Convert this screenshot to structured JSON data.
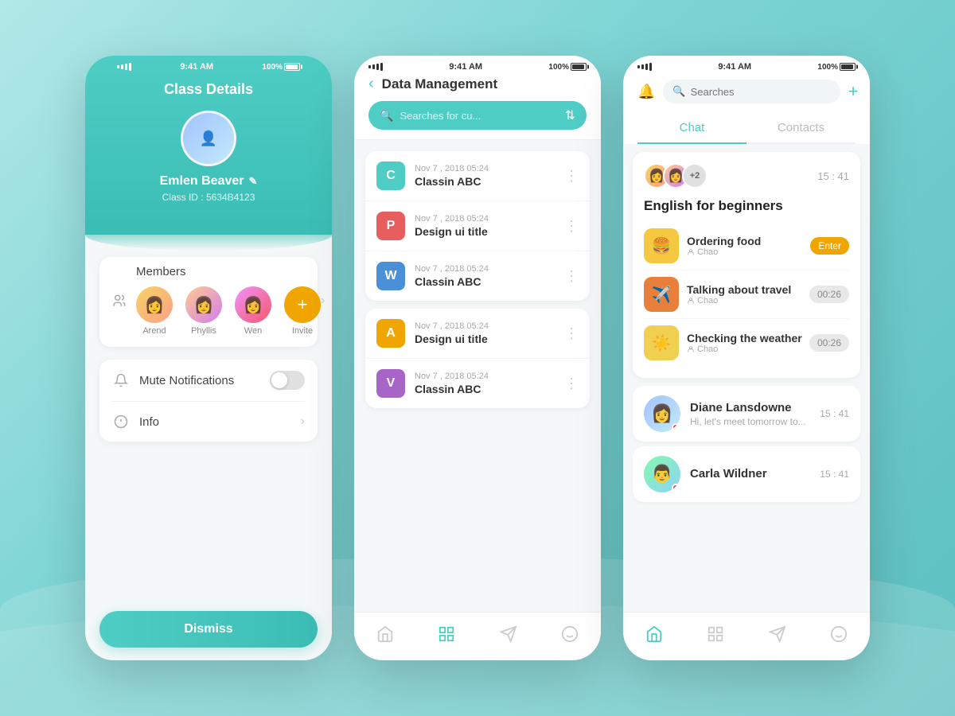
{
  "app": {
    "status_time": "9:41 AM",
    "status_battery": "100%"
  },
  "phone1": {
    "title": "Class Details",
    "user_name": "Emlen Beaver",
    "class_id": "Class ID : 5634B4123",
    "members_label": "Members",
    "mute_label": "Mute Notifications",
    "info_label": "Info",
    "dismiss_label": "Dismiss",
    "members": [
      {
        "name": "Arend"
      },
      {
        "name": "Phyllis"
      },
      {
        "name": "Wen"
      },
      {
        "name": "Invite"
      }
    ]
  },
  "phone2": {
    "title": "Data Management",
    "search_placeholder": "Searches for cu...",
    "files_group1": [
      {
        "date": "Nov 7 , 2018 05:24",
        "name": "Classin ABC",
        "type": "teal",
        "letter": "C"
      },
      {
        "date": "Nov 7 , 2018 05:24",
        "name": "Design ui title",
        "type": "red",
        "letter": "P"
      },
      {
        "date": "Nov 7 , 2018 05:24",
        "name": "Classin ABC",
        "type": "blue",
        "letter": "W"
      }
    ],
    "files_group2": [
      {
        "date": "Nov 7 , 2018 05:24",
        "name": "Design ui title",
        "type": "orange",
        "letter": "A"
      },
      {
        "date": "Nov 7 , 2018 05:24",
        "name": "Classin ABC",
        "type": "purple",
        "letter": "V"
      }
    ]
  },
  "phone3": {
    "search_placeholder": "Searches",
    "tab_chat": "Chat",
    "tab_contacts": "Contacts",
    "group": {
      "name": "English for beginners",
      "member_count": "+2",
      "time": "15 : 41",
      "lessons": [
        {
          "name": "Ordering food",
          "user": "Chao",
          "badge": "Enter",
          "badge_type": "enter"
        },
        {
          "name": "Talking about travel",
          "user": "Chao",
          "badge": "00:26",
          "badge_type": "time"
        },
        {
          "name": "Checking the weather",
          "user": "Chao",
          "badge": "00:26",
          "badge_type": "time"
        }
      ]
    },
    "chats": [
      {
        "name": "Diane Lansdowne",
        "preview": "Hi, let's meet tomorrow to...",
        "time": "15 : 41"
      },
      {
        "name": "Carla Wildner",
        "preview": "",
        "time": "15 : 41"
      }
    ]
  }
}
